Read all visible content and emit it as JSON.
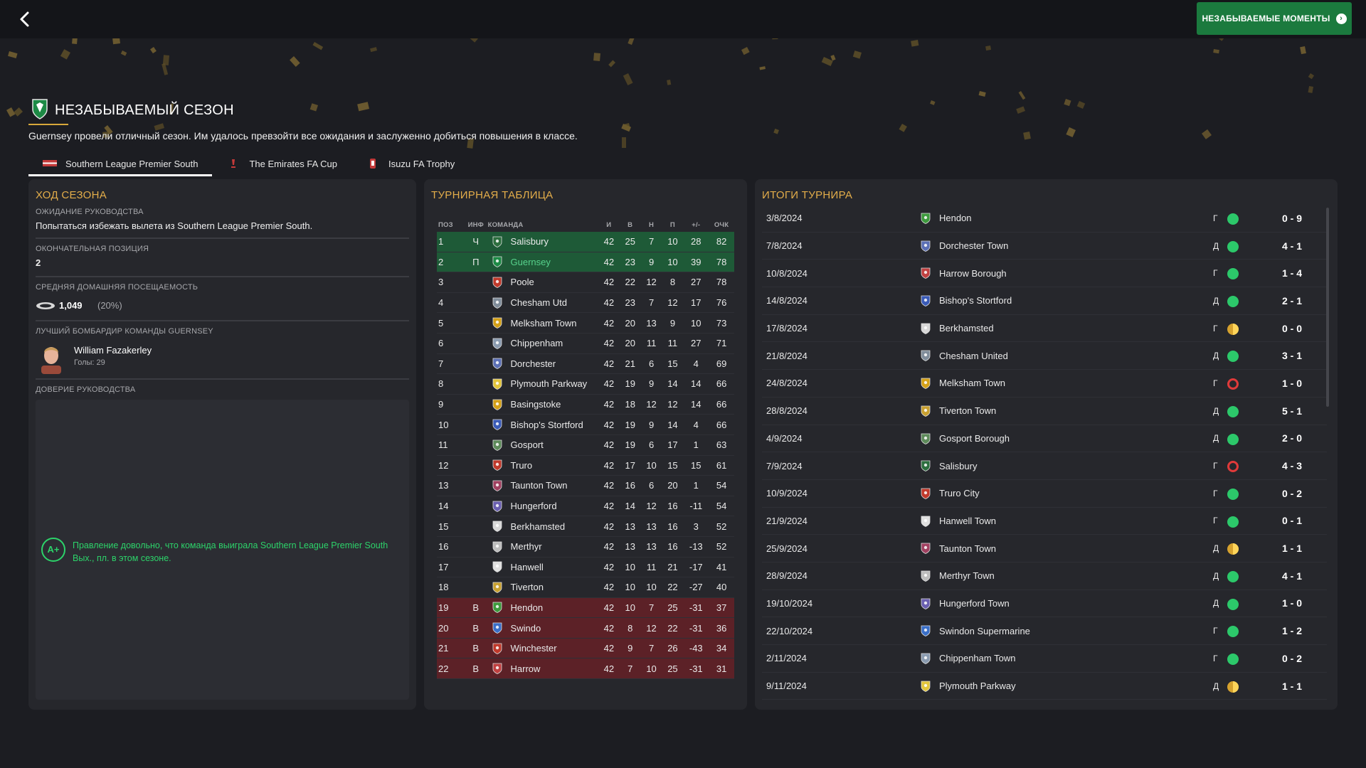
{
  "topbar": {
    "moments_button": "НЕЗАБЫВАЕМЫЕ МОМЕНТЫ"
  },
  "header": {
    "title": "НЕЗАБЫВАЕМЫЙ СЕЗОН",
    "subtitle": "Guernsey провели отличный сезон. Им удалось превзойти все ожидания и заслуженно добиться повышения в классе."
  },
  "tabs": [
    {
      "label": "Southern League Premier South",
      "active": true
    },
    {
      "label": "The Emirates FA Cup",
      "active": false
    },
    {
      "label": "Isuzu FA Trophy",
      "active": false
    }
  ],
  "season_progress": {
    "title": "ХОД СЕЗОНА",
    "expectation_label": "ОЖИДАНИЕ РУКОВОДСТВА",
    "expectation_value": "Попытаться избежать вылета из Southern League Premier South.",
    "final_position_label": "ОКОНЧАТЕЛЬНАЯ ПОЗИЦИЯ",
    "final_position_value": "2",
    "attendance_label": "СРЕДНЯЯ ДОМАШНЯЯ ПОСЕЩАЕМОСТЬ",
    "attendance_value": "1,049",
    "attendance_pct": "(20%)",
    "top_scorer_label": "ЛУЧШИЙ БОМБАРДИР КОМАНДЫ GUERNSEY",
    "top_scorer_name": "William Fazakerley",
    "top_scorer_goals": "Голы: 29",
    "board_trust_label": "ДОВЕРИЕ РУКОВОДСТВА",
    "board_grade": "A+",
    "board_message": "Правление довольно, что команда выиграла Southern League Premier South Вых., пл. в этом сезоне."
  },
  "league_table": {
    "title": "ТУРНИРНАЯ ТАБЛИЦА",
    "headers": [
      "ПОЗ",
      "ИНФ",
      "КОМАНДА",
      "И",
      "В",
      "Н",
      "П",
      "+/-",
      "ОЧК"
    ],
    "rows": [
      {
        "pos": "1",
        "inf": "Ч",
        "team": "Salisbury",
        "p": "42",
        "w": "25",
        "d": "7",
        "l": "10",
        "gd": "28",
        "pts": "82",
        "zone": "promo",
        "color": "#2c6e3e"
      },
      {
        "pos": "2",
        "inf": "П",
        "team": "Guernsey",
        "p": "42",
        "w": "23",
        "d": "9",
        "l": "10",
        "gd": "39",
        "pts": "78",
        "zone": "promo",
        "highlight": true,
        "color": "#1d8a45"
      },
      {
        "pos": "3",
        "inf": "",
        "team": "Poole",
        "p": "42",
        "w": "22",
        "d": "12",
        "l": "8",
        "gd": "27",
        "pts": "78",
        "zone": "",
        "color": "#c0392b"
      },
      {
        "pos": "4",
        "inf": "",
        "team": "Chesham Utd",
        "p": "42",
        "w": "23",
        "d": "7",
        "l": "12",
        "gd": "17",
        "pts": "76",
        "zone": "",
        "color": "#7f8c9a"
      },
      {
        "pos": "5",
        "inf": "",
        "team": "Melksham Town",
        "p": "42",
        "w": "20",
        "d": "13",
        "l": "9",
        "gd": "10",
        "pts": "73",
        "zone": "",
        "color": "#d4a017"
      },
      {
        "pos": "6",
        "inf": "",
        "team": "Chippenham",
        "p": "42",
        "w": "20",
        "d": "11",
        "l": "11",
        "gd": "27",
        "pts": "71",
        "zone": "",
        "color": "#8a9bb0"
      },
      {
        "pos": "7",
        "inf": "",
        "team": "Dorchester",
        "p": "42",
        "w": "21",
        "d": "6",
        "l": "15",
        "gd": "4",
        "pts": "69",
        "zone": "",
        "color": "#5b6fb5"
      },
      {
        "pos": "8",
        "inf": "",
        "team": "Plymouth Parkway",
        "p": "42",
        "w": "19",
        "d": "9",
        "l": "14",
        "gd": "14",
        "pts": "66",
        "zone": "",
        "color": "#e3c53a"
      },
      {
        "pos": "9",
        "inf": "",
        "team": "Basingstoke",
        "p": "42",
        "w": "18",
        "d": "12",
        "l": "12",
        "gd": "14",
        "pts": "66",
        "zone": "",
        "color": "#d4a017"
      },
      {
        "pos": "10",
        "inf": "",
        "team": "Bishop's Stortford",
        "p": "42",
        "w": "19",
        "d": "9",
        "l": "14",
        "gd": "4",
        "pts": "66",
        "zone": "",
        "color": "#3a5bb8"
      },
      {
        "pos": "11",
        "inf": "",
        "team": "Gosport",
        "p": "42",
        "w": "19",
        "d": "6",
        "l": "17",
        "gd": "1",
        "pts": "63",
        "zone": "",
        "color": "#5d8a5a"
      },
      {
        "pos": "12",
        "inf": "",
        "team": "Truro",
        "p": "42",
        "w": "17",
        "d": "10",
        "l": "15",
        "gd": "15",
        "pts": "61",
        "zone": "",
        "color": "#c0392b"
      },
      {
        "pos": "13",
        "inf": "",
        "team": "Taunton Town",
        "p": "42",
        "w": "16",
        "d": "6",
        "l": "20",
        "gd": "1",
        "pts": "54",
        "zone": "",
        "color": "#a04060"
      },
      {
        "pos": "14",
        "inf": "",
        "team": "Hungerford",
        "p": "42",
        "w": "14",
        "d": "12",
        "l": "16",
        "gd": "-11",
        "pts": "54",
        "zone": "",
        "color": "#6a5fb0"
      },
      {
        "pos": "15",
        "inf": "",
        "team": "Berkhamsted",
        "p": "42",
        "w": "13",
        "d": "13",
        "l": "16",
        "gd": "3",
        "pts": "52",
        "zone": "",
        "color": "#d8d8d8"
      },
      {
        "pos": "16",
        "inf": "",
        "team": "Merthyr",
        "p": "42",
        "w": "13",
        "d": "13",
        "l": "16",
        "gd": "-13",
        "pts": "52",
        "zone": "",
        "color": "#bdbdbd"
      },
      {
        "pos": "17",
        "inf": "",
        "team": "Hanwell",
        "p": "42",
        "w": "10",
        "d": "11",
        "l": "21",
        "gd": "-17",
        "pts": "41",
        "zone": "",
        "color": "#e0e0e0"
      },
      {
        "pos": "18",
        "inf": "",
        "team": "Tiverton",
        "p": "42",
        "w": "10",
        "d": "10",
        "l": "22",
        "gd": "-27",
        "pts": "40",
        "zone": "",
        "color": "#c8a030"
      },
      {
        "pos": "19",
        "inf": "В",
        "team": "Hendon",
        "p": "42",
        "w": "10",
        "d": "7",
        "l": "25",
        "gd": "-31",
        "pts": "37",
        "zone": "releg",
        "color": "#3d9a3d"
      },
      {
        "pos": "20",
        "inf": "В",
        "team": "Swindo",
        "p": "42",
        "w": "8",
        "d": "12",
        "l": "22",
        "gd": "-31",
        "pts": "36",
        "zone": "releg",
        "color": "#3a6fc8"
      },
      {
        "pos": "21",
        "inf": "В",
        "team": "Winchester",
        "p": "42",
        "w": "9",
        "d": "7",
        "l": "26",
        "gd": "-43",
        "pts": "34",
        "zone": "releg",
        "color": "#c0392b"
      },
      {
        "pos": "22",
        "inf": "В",
        "team": "Harrow",
        "p": "42",
        "w": "7",
        "d": "10",
        "l": "25",
        "gd": "-31",
        "pts": "31",
        "zone": "releg",
        "color": "#c04040"
      }
    ]
  },
  "results": {
    "title": "ИТОГИ ТУРНИРА",
    "rows": [
      {
        "date": "3/8/2024",
        "opponent": "Hendon",
        "venue": "Г",
        "result": "win",
        "score": "0 - 9",
        "color": "#3d9a3d"
      },
      {
        "date": "7/8/2024",
        "opponent": "Dorchester Town",
        "venue": "Д",
        "result": "win",
        "score": "4 - 1",
        "color": "#5b6fb5"
      },
      {
        "date": "10/8/2024",
        "opponent": "Harrow Borough",
        "venue": "Г",
        "result": "win",
        "score": "1 - 4",
        "color": "#c04040"
      },
      {
        "date": "14/8/2024",
        "opponent": "Bishop's Stortford",
        "venue": "Д",
        "result": "win",
        "score": "2 - 1",
        "color": "#3a5bb8"
      },
      {
        "date": "17/8/2024",
        "opponent": "Berkhamsted",
        "venue": "Г",
        "result": "draw",
        "score": "0 - 0",
        "color": "#d8d8d8"
      },
      {
        "date": "21/8/2024",
        "opponent": "Chesham United",
        "venue": "Д",
        "result": "win",
        "score": "3 - 1",
        "color": "#7f8c9a"
      },
      {
        "date": "24/8/2024",
        "opponent": "Melksham Town",
        "venue": "Г",
        "result": "loss",
        "score": "1 - 0",
        "color": "#d4a017"
      },
      {
        "date": "28/8/2024",
        "opponent": "Tiverton Town",
        "venue": "Д",
        "result": "win",
        "score": "5 - 1",
        "color": "#c8a030"
      },
      {
        "date": "4/9/2024",
        "opponent": "Gosport Borough",
        "venue": "Д",
        "result": "win",
        "score": "2 - 0",
        "color": "#5d8a5a"
      },
      {
        "date": "7/9/2024",
        "opponent": "Salisbury",
        "venue": "Г",
        "result": "loss",
        "score": "4 - 3",
        "color": "#2c6e3e"
      },
      {
        "date": "10/9/2024",
        "opponent": "Truro City",
        "venue": "Г",
        "result": "win",
        "score": "0 - 2",
        "color": "#c0392b"
      },
      {
        "date": "21/9/2024",
        "opponent": "Hanwell Town",
        "venue": "Г",
        "result": "win",
        "score": "0 - 1",
        "color": "#e0e0e0"
      },
      {
        "date": "25/9/2024",
        "opponent": "Taunton Town",
        "venue": "Д",
        "result": "draw",
        "score": "1 - 1",
        "color": "#a04060"
      },
      {
        "date": "28/9/2024",
        "opponent": "Merthyr Town",
        "venue": "Д",
        "result": "win",
        "score": "4 - 1",
        "color": "#bdbdbd"
      },
      {
        "date": "19/10/2024",
        "opponent": "Hungerford Town",
        "venue": "Д",
        "result": "win",
        "score": "1 - 0",
        "color": "#6a5fb0"
      },
      {
        "date": "22/10/2024",
        "opponent": "Swindon Supermarine",
        "venue": "Г",
        "result": "win",
        "score": "1 - 2",
        "color": "#3a6fc8"
      },
      {
        "date": "2/11/2024",
        "opponent": "Chippenham Town",
        "venue": "Г",
        "result": "win",
        "score": "0 - 2",
        "color": "#8a9bb0"
      },
      {
        "date": "9/11/2024",
        "opponent": "Plymouth Parkway",
        "venue": "Д",
        "result": "draw",
        "score": "1 - 1",
        "color": "#e3c53a"
      }
    ]
  },
  "colors": {
    "accent_gold": "#e3ad4a",
    "win": "#2cc86a",
    "draw": "#d6a22e",
    "loss": "#e03a3a",
    "promo_row": "#1e5a37",
    "releg_row": "#5c2127",
    "button_green": "#1b7a3e"
  }
}
